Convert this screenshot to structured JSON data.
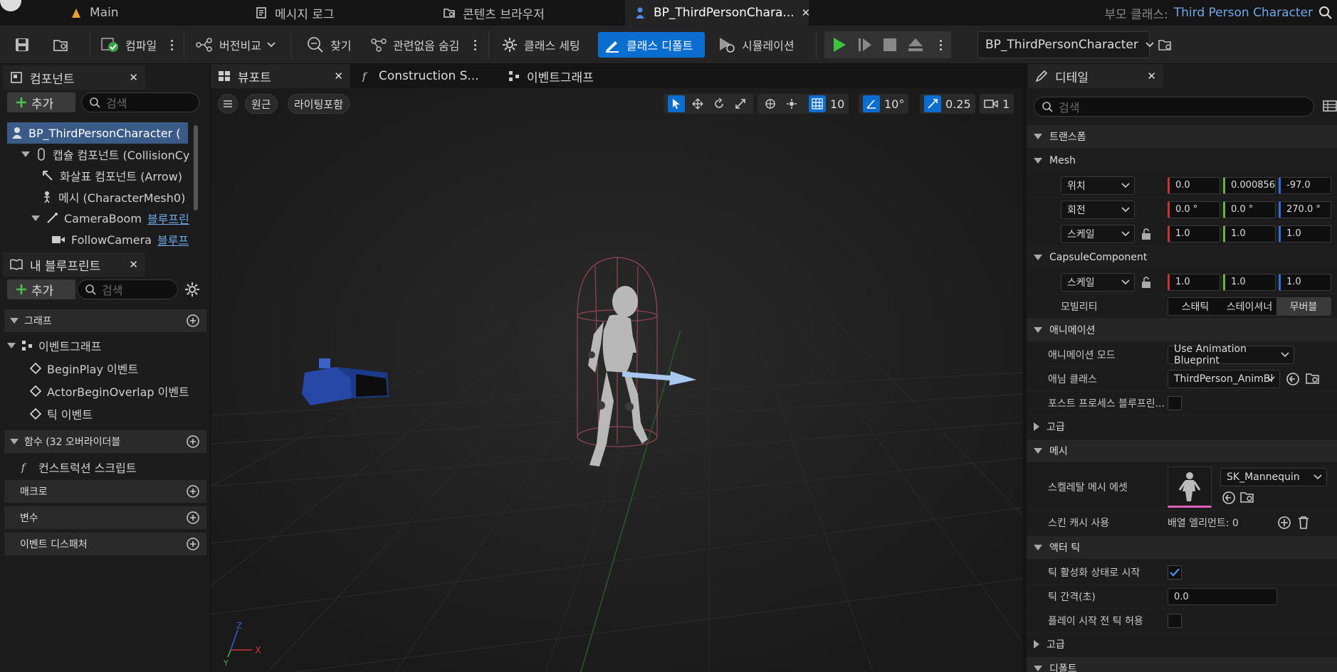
{
  "tabs": {
    "main": "Main",
    "log": "메시지 로그",
    "content": "콘텐츠 브라우저",
    "bp": "BP_ThirdPersonChara..."
  },
  "parent": {
    "label": "부모 클래스:",
    "value": "Third Person Character"
  },
  "toolbar": {
    "compile": "컴파일",
    "diff": "버전비교",
    "find": "찾기",
    "hide": "관련없음 숨김",
    "settings": "클래스 세팅",
    "defaults": "클래스 디폴트",
    "sim": "시뮬레이션",
    "bp_select": "BP_ThirdPersonCharacter"
  },
  "components": {
    "title": "컴포넌트",
    "add": "추가",
    "search": "검색",
    "items": [
      "BP_ThirdPersonCharacter (",
      "캡슐 컴포넌트 (CollisionCy",
      "화살표 컴포넌트 (Arrow)",
      "메시 (CharacterMesh0)",
      "CameraBoom",
      "FollowCamera"
    ],
    "boom_link": "블루프린",
    "cam_link": "블루프"
  },
  "myblueprint": {
    "title": "내 블루프린트",
    "add": "추가",
    "search": "검색",
    "graphs": "그래프",
    "eventgraph": "이벤트그래프",
    "events": [
      "BeginPlay 이벤트",
      "ActorBeginOverlap 이벤트",
      "틱 이벤트"
    ],
    "functions": "함수 (32 오버라이더블",
    "construct": "컨스트럭션 스크립트",
    "macros": "매크로",
    "vars": "변수",
    "dispatchers": "이벤트 디스패처"
  },
  "viewport": {
    "tab": "뷰포트",
    "tab2": "Construction S...",
    "tab3": "이벤트그래프",
    "persp": "원근",
    "lit": "라이팅포함",
    "grid": "10",
    "angle": "10°",
    "scale": "0.25",
    "cam": "1"
  },
  "details": {
    "title": "디테일",
    "search": "검색",
    "transform": "트랜스폼",
    "mesh": "Mesh",
    "loc": "위치",
    "loc_v": [
      "0.0",
      "0.000856",
      "-97.0"
    ],
    "rot": "회전",
    "rot_v": [
      "0.0 °",
      "0.0 °",
      "270.0 °"
    ],
    "scale": "스케일",
    "scale_v": [
      "1.0",
      "1.0",
      "1.0"
    ],
    "capsule": "CapsuleComponent",
    "cscale": "스케일",
    "cscale_v": [
      "1.0",
      "1.0",
      "1.0"
    ],
    "mobility": "모빌리티",
    "mob": [
      "스태틱",
      "스테이셔너",
      "무버블"
    ],
    "anim": "애니메이션",
    "animmode": "애니메이션 모드",
    "animmode_v": "Use Animation Blueprint",
    "animclass": "애님 클래스",
    "animclass_v": "ThirdPerson_AnimBl",
    "postproc": "포스트 프로세스 블루프린...",
    "adv": "고급",
    "meshsec": "메시",
    "skel": "스켈레탈 메시 에셋",
    "skel_v": "SK_Mannequin",
    "skincache": "스킨 캐시 사용",
    "array": "배열 엘리먼트: 0",
    "tick": "액터 틱",
    "tickstart": "틱 활성화 상태로 시작",
    "tickint": "틱 간격(초)",
    "tickint_v": "0.0",
    "tickpre": "플레이 시작 전 틱 허용",
    "adv2": "고급",
    "defaults": "디폴트"
  },
  "colors": {
    "accent": "#0a6ed1",
    "link": "#6fa8e8"
  }
}
